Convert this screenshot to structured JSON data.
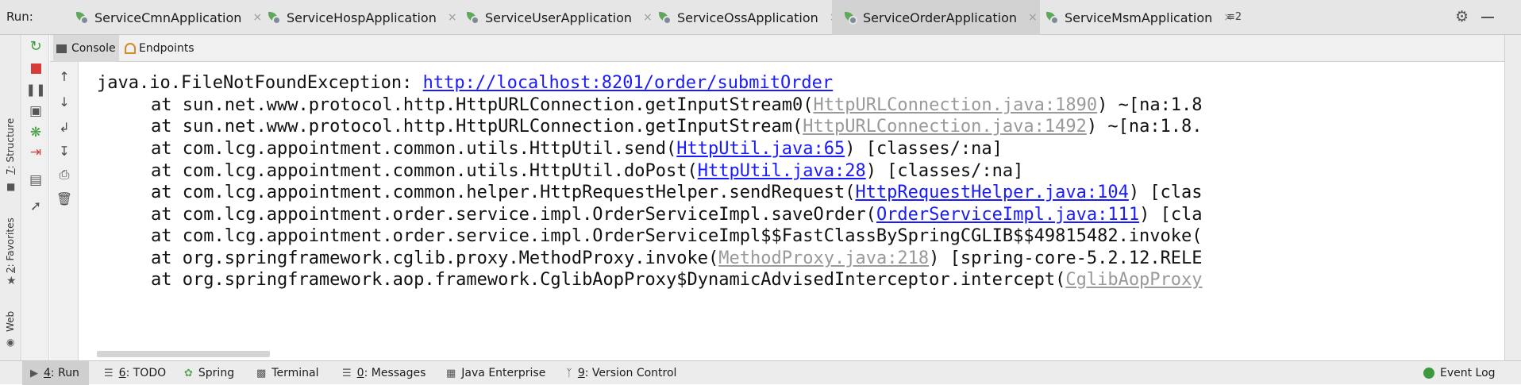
{
  "run_bar": {
    "label": "Run:",
    "tabs": [
      {
        "label": "ServiceCmnApplication",
        "close": "×",
        "active": false
      },
      {
        "label": "ServiceHospApplication",
        "close": "×",
        "active": false
      },
      {
        "label": "ServiceUserApplication",
        "close": "×",
        "active": false
      },
      {
        "label": "ServiceOssApplication",
        "close": "×",
        "active": false
      },
      {
        "label": "ServiceOrderApplication",
        "close": "×",
        "active": true
      },
      {
        "label": "ServiceMsmApplication",
        "close": "×",
        "active": false
      }
    ],
    "more_tabs": "≡2",
    "more_icon": "tab-list-icon",
    "settings_icon": "gear-icon",
    "minimize_icon": "minimize-icon"
  },
  "left_stripe": {
    "structure": {
      "number": "7",
      "label": ": Structure"
    },
    "favorites": {
      "number": "2",
      "label": ": Favorites"
    },
    "web": {
      "label": "Web"
    }
  },
  "console_tabs": [
    {
      "label": "Console",
      "active": true
    },
    {
      "label": "Endpoints",
      "active": false
    }
  ],
  "console": {
    "exception": "java.io.FileNotFoundException: ",
    "exception_url": "http://localhost:8201/order/submitOrder",
    "frames": [
      {
        "at": "at ",
        "method": "sun.net.www.protocol.http.HttpURLConnection.getInputStream0(",
        "source": "HttpURLConnection.java:1890",
        "source_style": "gray",
        "suffix": ") ~[na:1.8"
      },
      {
        "at": "at ",
        "method": "sun.net.www.protocol.http.HttpURLConnection.getInputStream(",
        "source": "HttpURLConnection.java:1492",
        "source_style": "gray",
        "suffix": ") ~[na:1.8."
      },
      {
        "at": "at ",
        "method": "com.lcg.appointment.common.utils.HttpUtil.send(",
        "source": "HttpUtil.java:65",
        "source_style": "link",
        "suffix": ") [classes/:na]"
      },
      {
        "at": "at ",
        "method": "com.lcg.appointment.common.utils.HttpUtil.doPost(",
        "source": "HttpUtil.java:28",
        "source_style": "link",
        "suffix": ") [classes/:na]"
      },
      {
        "at": "at ",
        "method": "com.lcg.appointment.common.helper.HttpRequestHelper.sendRequest(",
        "source": "HttpRequestHelper.java:104",
        "source_style": "link",
        "suffix": ") [clas"
      },
      {
        "at": "at ",
        "method": "com.lcg.appointment.order.service.impl.OrderServiceImpl.saveOrder(",
        "source": "OrderServiceImpl.java:111",
        "source_style": "link",
        "suffix": ") [cla"
      },
      {
        "at": "at ",
        "method": "com.lcg.appointment.order.service.impl.OrderServiceImpl$$FastClassBySpringCGLIB$$49815482.invoke(",
        "source": "",
        "source_style": "none",
        "suffix": ""
      },
      {
        "at": "at ",
        "method": "org.springframework.cglib.proxy.MethodProxy.invoke(",
        "source": "MethodProxy.java:218",
        "source_style": "gray",
        "suffix": ") [spring-core-5.2.12.RELE"
      },
      {
        "at": "at ",
        "method": "org.springframework.aop.framework.CglibAopProxy$DynamicAdvisedInterceptor.intercept(",
        "source": "CglibAopProxy",
        "source_style": "gray",
        "suffix": ""
      }
    ]
  },
  "bottom_bar": {
    "tools": [
      {
        "number": "4",
        "label": ": Run",
        "active": true,
        "icon": "run-icon"
      },
      {
        "number": "6",
        "label": ": TODO",
        "active": false,
        "icon": "todo-icon"
      },
      {
        "number": "",
        "label": "Spring",
        "active": false,
        "icon": "spring-icon"
      },
      {
        "number": "",
        "label": "Terminal",
        "active": false,
        "icon": "terminal-icon"
      },
      {
        "number": "0",
        "label": ": Messages",
        "active": false,
        "icon": "messages-icon"
      },
      {
        "number": "",
        "label": "Java Enterprise",
        "active": false,
        "icon": "java-enterprise-icon"
      },
      {
        "number": "9",
        "label": ": Version Control",
        "active": false,
        "icon": "version-control-icon"
      }
    ],
    "event_log": "Event Log"
  },
  "colors": {
    "link": "#1a1aff",
    "muted_source": "#9a9a9a",
    "rerun": "#3f9c3f",
    "stop": "#d93a3a",
    "spring_green": "#5ea85a"
  }
}
